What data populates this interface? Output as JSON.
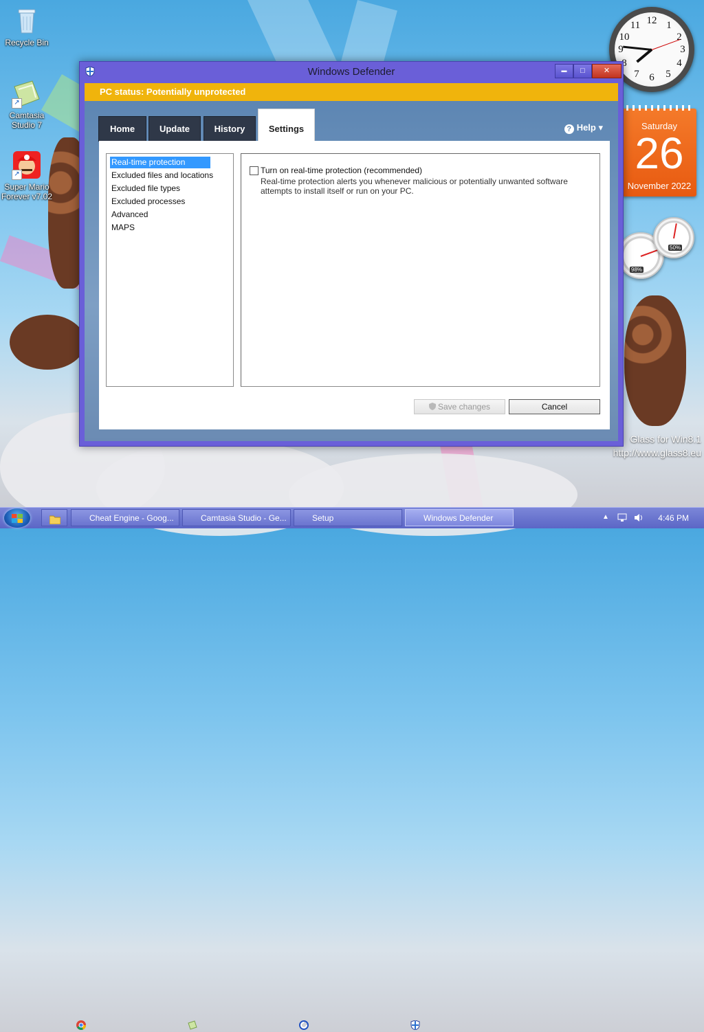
{
  "desktop": {
    "icons": [
      {
        "label": "Recycle Bin"
      },
      {
        "label": "Camtasia Studio 7"
      },
      {
        "label": "Super Mario Forever v7.02"
      }
    ],
    "calendar": {
      "day": "Saturday",
      "date": "26",
      "month": "November 2022"
    },
    "meters": {
      "cpu": "98%",
      "memory": "50%"
    },
    "watermark": {
      "line1": "Glass for Win8.1",
      "line2": "http://www.glass8.eu"
    }
  },
  "window": {
    "title": "Windows Defender",
    "controls": {
      "minimize": "▬",
      "maximize": "□",
      "close": "✕"
    },
    "status": "PC status: Potentially unprotected",
    "tabs": [
      {
        "label": "Home"
      },
      {
        "label": "Update"
      },
      {
        "label": "History"
      },
      {
        "label": "Settings",
        "active": true
      }
    ],
    "help": {
      "icon": "?",
      "label": "Help ▾"
    },
    "settings_nav": [
      {
        "label": "Real-time protection",
        "selected": true
      },
      {
        "label": "Excluded files and locations"
      },
      {
        "label": "Excluded file types"
      },
      {
        "label": "Excluded processes"
      },
      {
        "label": "Advanced"
      },
      {
        "label": "MAPS"
      }
    ],
    "realtime": {
      "checkbox_label": "Turn on real-time protection (recommended)",
      "checked": false,
      "description": "Real-time protection alerts you whenever malicious or potentially unwanted software attempts to install itself or run on your PC."
    },
    "buttons": {
      "save": "Save changes",
      "cancel": "Cancel"
    }
  },
  "taskbar": {
    "items": [
      {
        "label": "Cheat Engine - Goog..."
      },
      {
        "label": "Camtasia Studio - Ge..."
      },
      {
        "label": "Setup"
      },
      {
        "label": "Windows Defender",
        "active": true
      }
    ],
    "time": "4:46 PM"
  },
  "colors": {
    "status_bar": "#f0b40c",
    "window_frame": "#6a5fd8",
    "selection": "#3399ff"
  }
}
